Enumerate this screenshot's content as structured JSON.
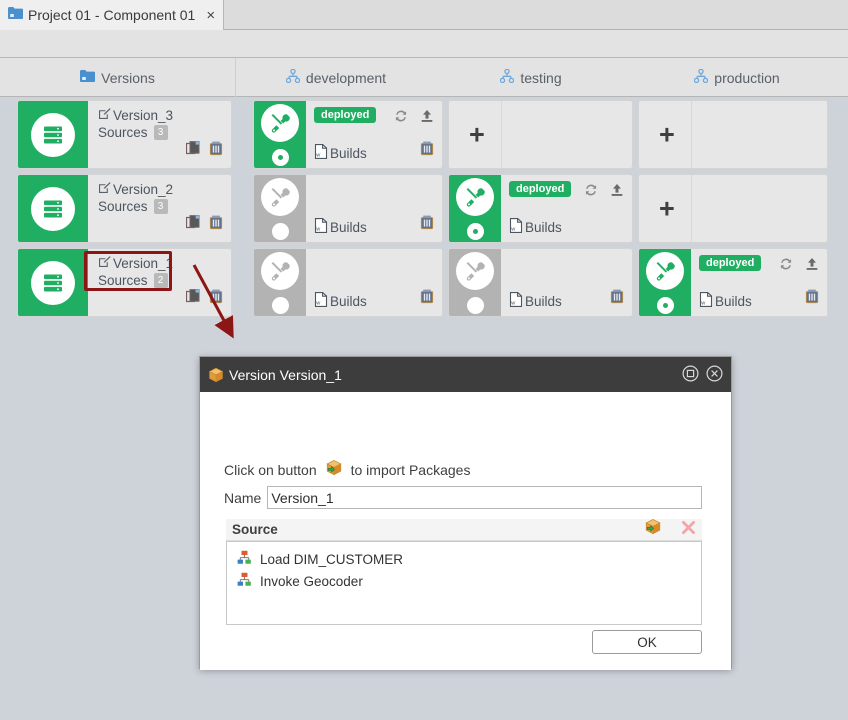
{
  "window": {
    "project_tab_label": "Project 01 - Component 01",
    "project_tab_close": "×",
    "folder_icon": "folder-icon"
  },
  "columns": [
    {
      "label": "Versions",
      "icon": "folder-icon"
    },
    {
      "label": "development",
      "icon": "pipeline-icon"
    },
    {
      "label": "testing",
      "icon": "pipeline-icon"
    },
    {
      "label": "production",
      "icon": "pipeline-icon"
    }
  ],
  "versions": [
    {
      "name": "Version_3",
      "sources_label": "Sources",
      "sources_count": "3",
      "highlighted": false
    },
    {
      "name": "Version_2",
      "sources_label": "Sources",
      "sources_count": "3",
      "highlighted": false
    },
    {
      "name": "Version_1",
      "sources_label": "Sources",
      "sources_count": "2",
      "highlighted": true
    }
  ],
  "stages": {
    "development": [
      {
        "type": "build",
        "deployed": true,
        "status_label": "deployed",
        "builds_label": "Builds"
      },
      {
        "type": "build",
        "deployed": false,
        "status_label": "",
        "builds_label": "Builds"
      },
      {
        "type": "build",
        "deployed": false,
        "status_label": "",
        "builds_label": "Builds"
      }
    ],
    "testing": [
      {
        "type": "add",
        "deployed": false,
        "status_label": "",
        "builds_label": ""
      },
      {
        "type": "build",
        "deployed": true,
        "status_label": "deployed",
        "builds_label": "Builds"
      },
      {
        "type": "build",
        "deployed": false,
        "status_label": "",
        "builds_label": "Builds"
      }
    ],
    "production": [
      {
        "type": "add",
        "deployed": false,
        "status_label": "",
        "builds_label": ""
      },
      {
        "type": "add",
        "deployed": false,
        "status_label": "",
        "builds_label": ""
      },
      {
        "type": "build",
        "deployed": true,
        "status_label": "deployed",
        "builds_label": "Builds"
      }
    ]
  },
  "dialog": {
    "title": "Version Version_1",
    "title_icon": "package-icon",
    "maximize_icon": "maximize-icon",
    "close_icon": "close-icon",
    "hint_prefix": "Click on button",
    "hint_suffix": "to import Packages",
    "hint_icon": "import-package-icon",
    "name_label": "Name",
    "name_value": "Version_1",
    "name_placeholder": "",
    "source_section_label": "Source",
    "source_add_icon": "import-package-icon",
    "source_remove_icon": "remove-x-icon",
    "source_items": [
      {
        "label": "Load DIM_CUSTOMER",
        "icon": "process-icon"
      },
      {
        "label": "Invoke Geocoder",
        "icon": "process-icon"
      }
    ],
    "ok_label": "OK"
  },
  "annotation": {
    "highlight_color": "#8c1515",
    "arrow_color": "#8c1515"
  },
  "colors": {
    "green": "#20af62",
    "grey": "#b3b3b3",
    "background": "#ced3da",
    "dialog_titlebar": "#3d3d3d"
  }
}
